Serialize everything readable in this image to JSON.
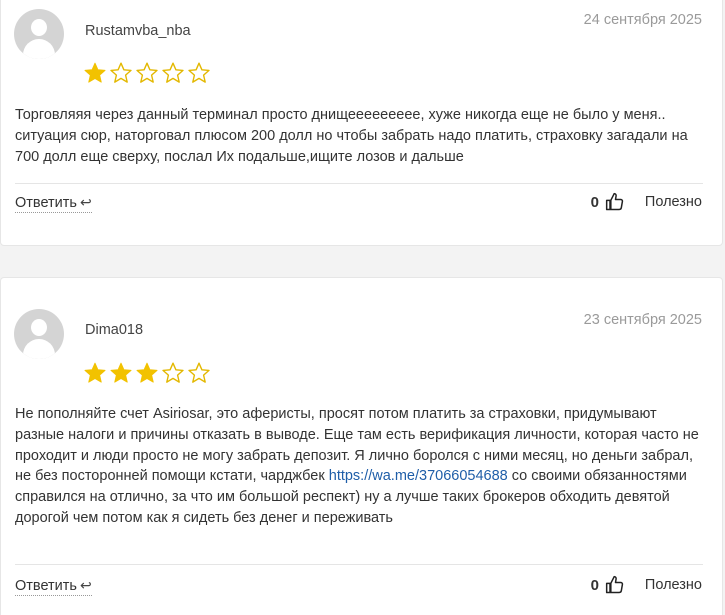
{
  "reviews": [
    {
      "author": "Rustamvba_nba",
      "date": "24 сентября 2025",
      "rating": 1,
      "max_rating": 5,
      "text": "Торговляяя через данный терминал просто днищеееееееее, хуже никогда еще не было у меня.. ситуация сюр, наторговал плюсом 200 долл но чтобы забрать надо платить, страховку загадали на 700 долл еще сверху, послал Их подальше,ищите лозов и дальше",
      "reply_label": "Ответить",
      "votes": "0",
      "helpful_label": "Полезно"
    },
    {
      "author": "Dima018",
      "date": "23 сентября 2025",
      "rating": 3,
      "max_rating": 5,
      "text_before_link": "Не пополняйте счет Asiriosar, это аферисты, просят потом платить за страховки, придумывают разные налоги и причины отказать в выводе. Еще там есть верификация личности, которая часто не проходит и люди просто не могу забрать депозит. Я лично боролся с ними месяц, но деньги забрал, не без посторонней помощи кстати, чарджбек ",
      "link_text": "https://wa.me/37066054688",
      "text_after_link": " со своими обязанностями справился на отлично, за что им большой респект) ну а лучше таких брокеров обходить девятой дорогой чем потом как я сидеть без денег и переживать",
      "reply_label": "Ответить",
      "votes": "0",
      "helpful_label": "Полезно"
    }
  ],
  "colors": {
    "star_filled": "#f2c200",
    "star_outline": "#e3b800",
    "link": "#1f5ea8",
    "date": "#9a9a9a"
  },
  "icons": {
    "avatar": "default-user-avatar",
    "star": "star-icon",
    "reply": "reply-arrow-icon",
    "thumb": "thumbs-up-icon"
  }
}
